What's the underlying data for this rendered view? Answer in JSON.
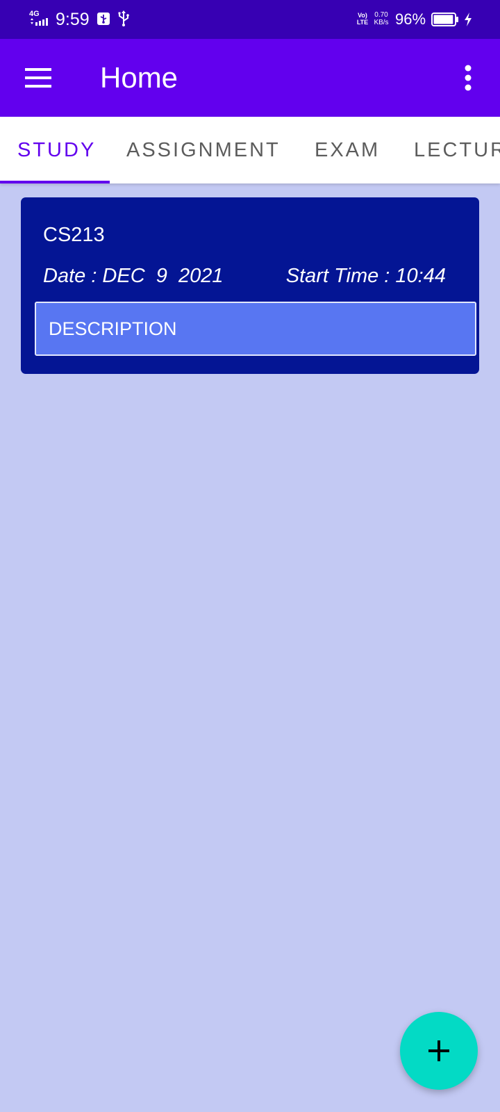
{
  "status_bar": {
    "network": "4G",
    "time": "9:59",
    "volte_top": "Vo)",
    "volte_bottom": "LTE",
    "speed_value": "0.70",
    "speed_unit": "KB/s",
    "battery_percent": "96%",
    "battery_level": 0.96
  },
  "app_bar": {
    "title": "Home"
  },
  "tabs": [
    {
      "label": "STUDY",
      "active": true
    },
    {
      "label": "ASSIGNMENT",
      "active": false
    },
    {
      "label": "EXAM",
      "active": false
    },
    {
      "label": "LECTUR",
      "active": false
    }
  ],
  "card": {
    "title": "CS213",
    "date": "Date : DEC  9  2021",
    "start_time": "Start Time : 10:44",
    "description": "DESCRIPTION"
  },
  "fab": {
    "icon": "plus-icon"
  },
  "colors": {
    "status_bar": "#3700b3",
    "primary": "#6200ee",
    "background": "#c3c9f3",
    "card": "#041594",
    "description_field": "#5876f2",
    "fab": "#03dac5"
  }
}
